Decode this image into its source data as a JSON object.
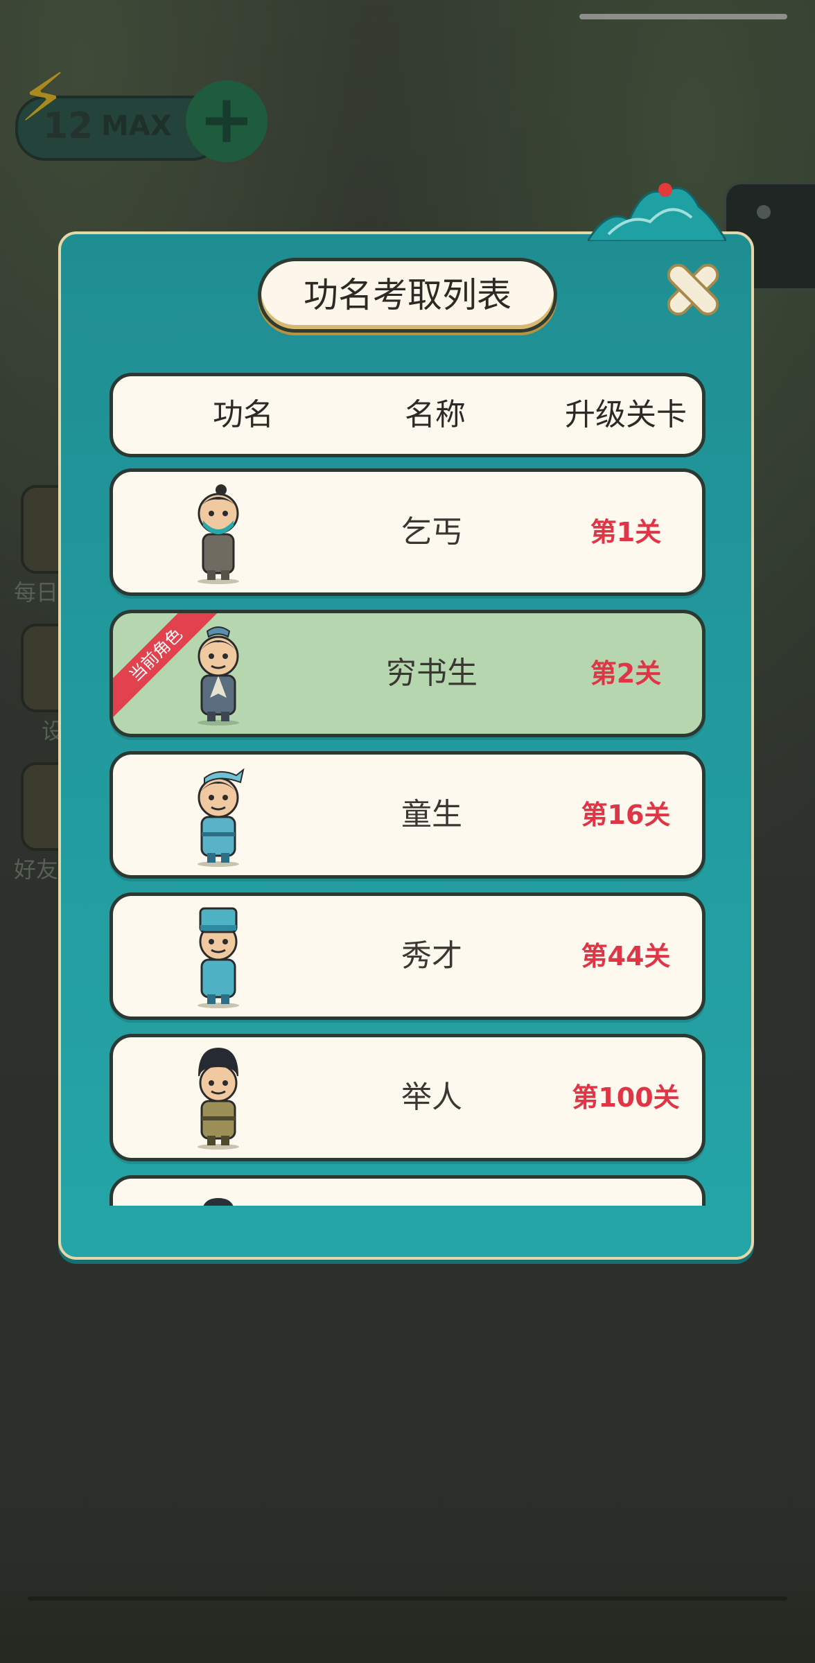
{
  "status": {
    "energy_value": "12",
    "energy_max_label": "MAX",
    "add_energy_symbol": "+"
  },
  "background": {
    "side_labels": [
      "每日",
      "设",
      "好友"
    ]
  },
  "dialog": {
    "title": "功名考取列表",
    "close_label": "关闭",
    "columns": [
      "功名",
      "名称",
      "升级关卡"
    ],
    "current_badge": "当前角色",
    "rows": [
      {
        "name": "乞丐",
        "level": "第1关",
        "current": false,
        "portrait": "beggar-icon"
      },
      {
        "name": "穷书生",
        "level": "第2关",
        "current": true,
        "portrait": "poor-scholar-icon"
      },
      {
        "name": "童生",
        "level": "第16关",
        "current": false,
        "portrait": "child-student-icon"
      },
      {
        "name": "秀才",
        "level": "第44关",
        "current": false,
        "portrait": "xiucai-icon"
      },
      {
        "name": "举人",
        "level": "第100关",
        "current": false,
        "portrait": "juren-icon"
      },
      {
        "name": "",
        "level": "",
        "current": false,
        "portrait": "next-rank-icon"
      }
    ]
  },
  "colors": {
    "dialog_teal": "#21989c",
    "row_cream": "#fdf9ee",
    "current_row_green": "#b6d6b0",
    "level_red": "#e03546",
    "badge_red": "#e2424e"
  }
}
